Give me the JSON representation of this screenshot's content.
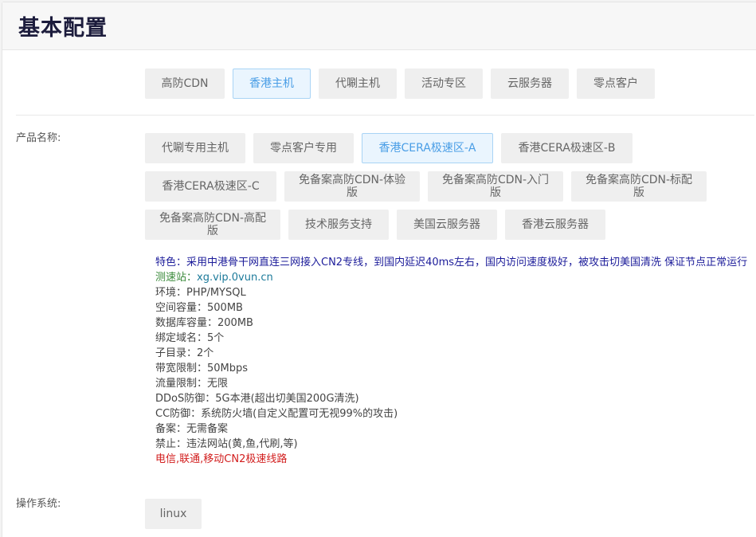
{
  "header": {
    "title": "基本配置"
  },
  "categories": {
    "items": [
      "高防CDN",
      "香港主机",
      "代唰主机",
      "活动专区",
      "云服务器",
      "零点客户"
    ],
    "active_index": 1
  },
  "product": {
    "label": "产品名称:",
    "rows": [
      [
        "代唰专用主机",
        "零点客户专用",
        "香港CERA极速区-A",
        "香港CERA极速区-B"
      ],
      [
        "香港CERA极速区-C",
        "免备案高防CDN-体验版",
        "免备案高防CDN-入门版",
        "免备案高防CDN-标配版"
      ],
      [
        "免备案高防CDN-高配版",
        "技术服务支持",
        "美国云服务器",
        "香港云服务器"
      ]
    ],
    "active": "香港CERA极速区-A"
  },
  "description": {
    "feature": "特色：采用中港骨干网直连三网接入CN2专线，到国内延迟40ms左右，国内访问速度极好，被攻击切美国清洗 保证节点正常运行",
    "speed_label": "测速站：",
    "speed_url": "xg.vip.0vun.cn",
    "env": "环境：PHP/MYSQL",
    "space": "空间容量：500MB",
    "db": "数据库容量：200MB",
    "domains": "绑定域名：5个",
    "subdirs": "子目录：2个",
    "bandwidth": "带宽限制：50Mbps",
    "traffic": "流量限制：无限",
    "ddos": "DDoS防御：5G本港(超出切美国200G清洗)",
    "cc": "CC防御：系统防火墙(自定义配置可无视99%的攻击)",
    "icp": "备案：无需备案",
    "forbidden": "禁止：违法网站(黄,鱼,代刷,等)",
    "lines": "电信,联通,移动CN2极速线路"
  },
  "os": {
    "label": "操作系统:",
    "options": [
      "linux"
    ]
  }
}
